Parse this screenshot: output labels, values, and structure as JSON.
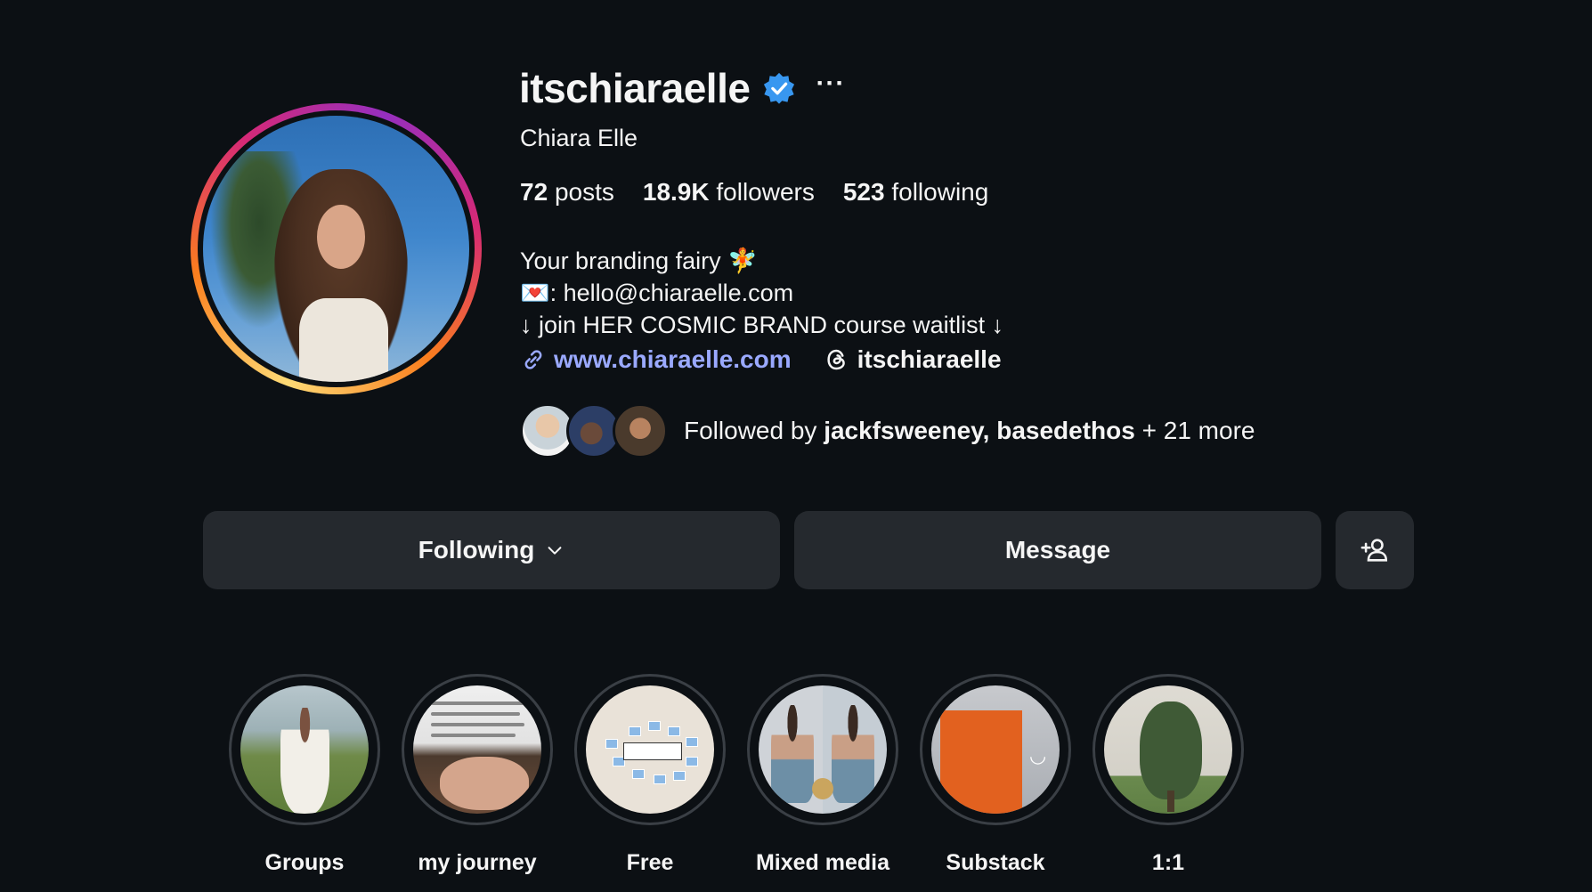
{
  "profile": {
    "username": "itschiaraelle",
    "full_name": "Chiara Elle",
    "verified": true,
    "more_label": "···"
  },
  "stats": {
    "posts_count": "72",
    "posts_label": "posts",
    "followers_count": "18.9K",
    "followers_label": "followers",
    "following_count": "523",
    "following_label": "following"
  },
  "bio": {
    "line1": "Your branding fairy 🧚",
    "line2_icon": "💌",
    "line2": ": hello@chiaraelle.com",
    "line3": "↓ join HER COSMIC BRAND course waitlist ↓",
    "website": "www.chiaraelle.com",
    "threads_handle": "itschiaraelle"
  },
  "followed_by": {
    "prefix": "Followed by ",
    "names": "jackfsweeney, basedethos",
    "suffix": " + 21 more"
  },
  "actions": {
    "following_label": "Following",
    "message_label": "Message",
    "add_icon": "person-add-icon"
  },
  "highlights": [
    {
      "label": "Groups"
    },
    {
      "label": "my journey"
    },
    {
      "label": "Free"
    },
    {
      "label": "Mixed media"
    },
    {
      "label": "Substack"
    },
    {
      "label": "1:1"
    }
  ],
  "colors": {
    "background": "#0c1014",
    "button_bg": "#25292e",
    "link": "#9aa9ff",
    "verified": "#3897f0"
  }
}
